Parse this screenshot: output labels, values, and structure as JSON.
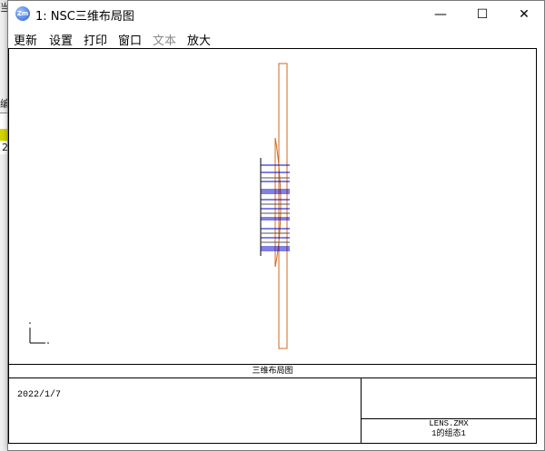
{
  "background": {
    "fragments": [
      "当",
      "编",
      "2"
    ]
  },
  "window": {
    "icon_label": "Zm",
    "title": "1: NSC三维布局图",
    "controls": {
      "minimize": "—",
      "maximize": "☐",
      "close": "✕"
    }
  },
  "menu": {
    "items": [
      {
        "label": "更新",
        "enabled": true
      },
      {
        "label": "设置",
        "enabled": true
      },
      {
        "label": "打印",
        "enabled": true
      },
      {
        "label": "窗口",
        "enabled": true
      },
      {
        "label": "文本",
        "enabled": false
      },
      {
        "label": "放大",
        "enabled": true
      }
    ]
  },
  "footer": {
    "plot_title": "三维布局图",
    "date": "2022/1/7",
    "file_name": "LENS.ZMX",
    "config": "1的组态1"
  },
  "colors": {
    "accent_orange": "#d2691e",
    "ray_blue": "#0000cc",
    "highlight_yellow": "#d4d400"
  }
}
